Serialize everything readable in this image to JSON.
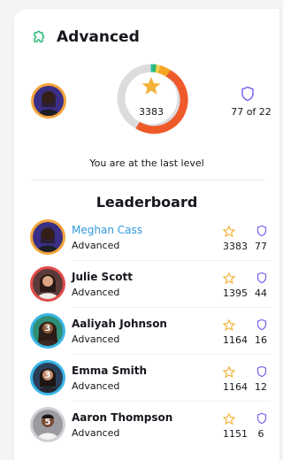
{
  "header": {
    "title": "Advanced",
    "icon": "puzzle-icon"
  },
  "current_user": {
    "points": "3383",
    "rank_text": "77 of 22",
    "level_text": "You are at the last level",
    "progress": 0.75
  },
  "leaderboard": {
    "title": "Leaderboard",
    "rows": [
      {
        "rank": "",
        "name": "Meghan Cass",
        "level": "Advanced",
        "points": "3383",
        "place": "77",
        "ring_color": "#f3a43a",
        "highlight": true
      },
      {
        "rank": "",
        "name": "Julie Scott",
        "level": "Advanced",
        "points": "1395",
        "place": "44",
        "ring_color": "#e24b4b",
        "highlight": false
      },
      {
        "rank": "3",
        "name": "Aaliyah Johnson",
        "level": "Advanced",
        "points": "1164",
        "place": "16",
        "ring_color": "#39b6e6",
        "highlight": false
      },
      {
        "rank": "3",
        "name": "Emma Smith",
        "level": "Advanced",
        "points": "1164",
        "place": "12",
        "ring_color": "#39b6e6",
        "highlight": false
      },
      {
        "rank": "5",
        "name": "Aaron Thompson",
        "level": "Advanced",
        "points": "1151",
        "place": "6",
        "ring_color": "#cfcfd4",
        "highlight": false
      }
    ]
  },
  "colors": {
    "accent_green": "#2bb673",
    "star": "#f2b33a",
    "shield": "#7b5cf0",
    "link": "#2f9be0",
    "ring_track": "#dcdcdf",
    "ring_red": "#ef5a2a",
    "ring_orange": "#f5a623",
    "ring_yellow": "#f7d343",
    "ring_green": "#2bb673",
    "ring_teal": "#26c1a5"
  }
}
